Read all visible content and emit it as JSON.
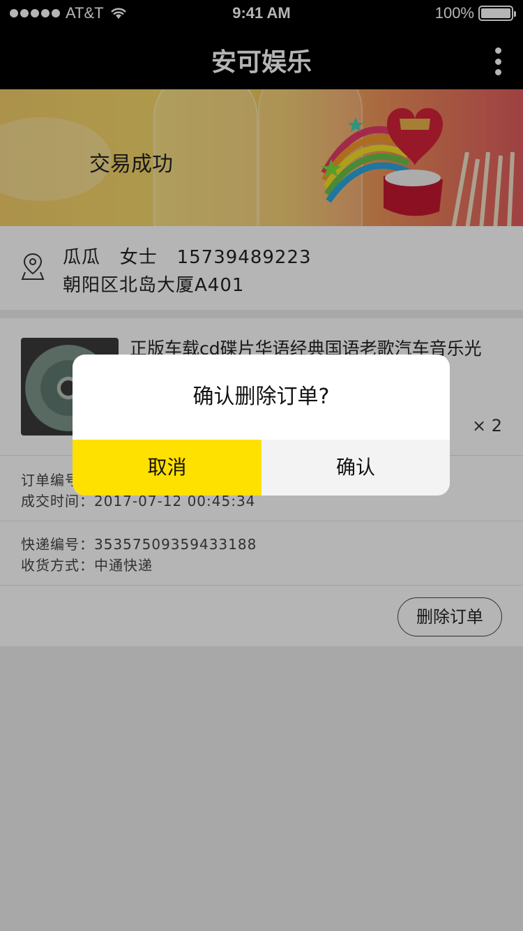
{
  "status_bar": {
    "carrier": "AT&T",
    "time": "9:41 AM",
    "battery": "100%"
  },
  "nav": {
    "title": "安可娱乐",
    "more_icon": "more-vertical-icon"
  },
  "banner": {
    "status_text": "交易成功"
  },
  "address": {
    "name_line": "瓜瓜   女士   15739489223",
    "address_line": "朝阳区北岛大厦A401",
    "icon": "location-pin-icon"
  },
  "order": {
    "product_title": "正版车载cd碟片华语经典国语老歌汽车音乐光",
    "quantity": "× 2",
    "order_no_label": "订单编号：",
    "deal_time": "成交时间：2017-07-12 00:45:34",
    "express_no": "快递编号：35357509359433188",
    "delivery_method": "收货方式：中通快递",
    "delete_label": "删除订单"
  },
  "dialog": {
    "message": "确认删除订单?",
    "cancel_label": "取消",
    "confirm_label": "确认"
  },
  "colors": {
    "accent": "#ffe100",
    "nav_bg": "#000000"
  }
}
